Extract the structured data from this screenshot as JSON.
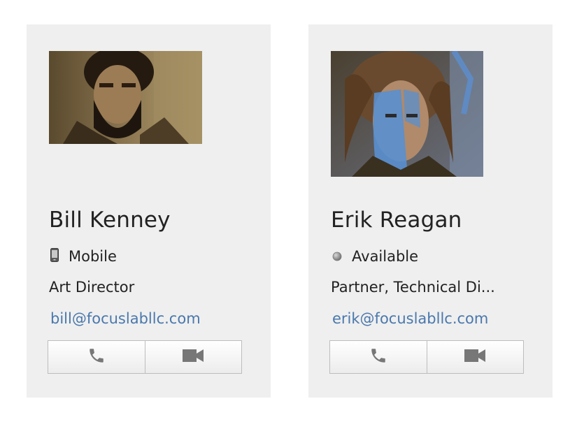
{
  "contacts": [
    {
      "name": "Bill Kenney",
      "status": {
        "label": "Mobile",
        "icon": "mobile-phone-icon"
      },
      "title": "Art Director",
      "email": "bill@focuslabllc.com",
      "photo_alt": "Bill Kenney photo",
      "actions": {
        "call_icon": "phone-icon",
        "video_icon": "video-camera-icon"
      }
    },
    {
      "name": "Erik Reagan",
      "status": {
        "label": "Available",
        "icon": "status-dot-icon"
      },
      "title": "Partner, Technical Di...",
      "email": "erik@focuslabllc.com",
      "photo_alt": "Erik Reagan photo",
      "actions": {
        "call_icon": "phone-icon",
        "video_icon": "video-camera-icon"
      }
    }
  ],
  "colors": {
    "card_bg": "#efefef",
    "link": "#4a78ad",
    "icon_gray": "#777777"
  }
}
